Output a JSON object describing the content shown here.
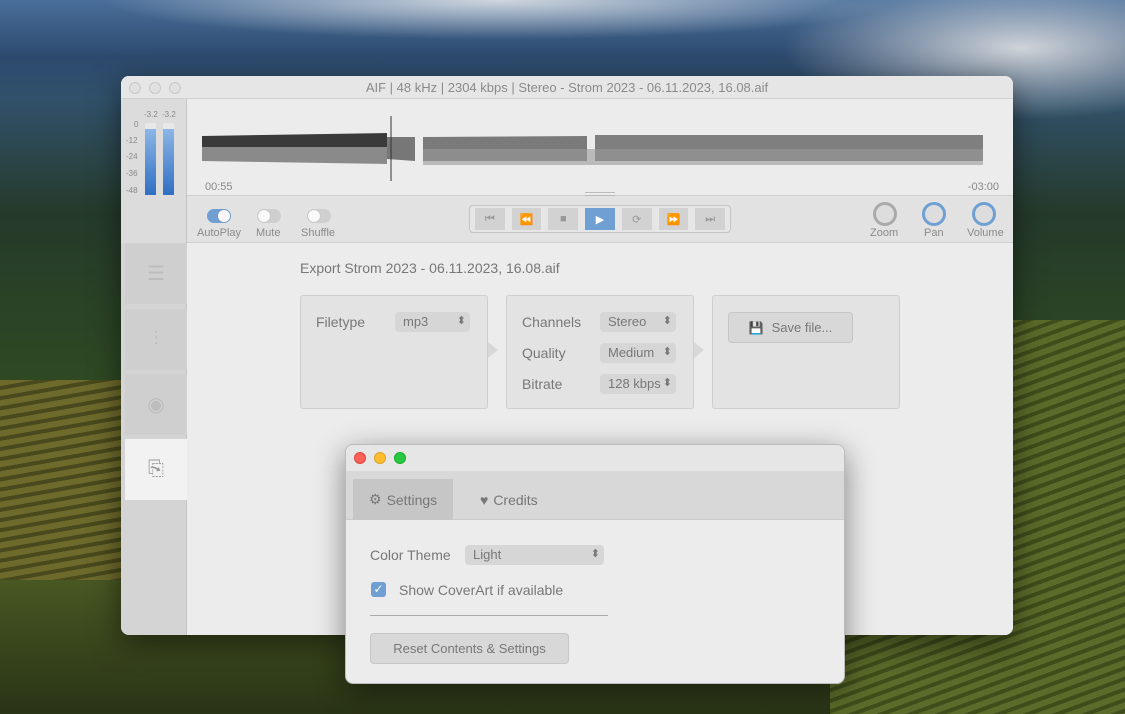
{
  "main_window": {
    "title": "AIF | 48 kHz | 2304 kbps | Stereo - Strom 2023 - 06.11.2023, 16.08.aif",
    "meter": {
      "peak_left": "-3.2",
      "peak_right": "-3.2",
      "scale": [
        "0",
        "-12",
        "-24",
        "-36",
        "-48"
      ],
      "level_left": 0.92,
      "level_right": 0.92
    },
    "waveform": {
      "elapsed": "00:55",
      "remaining": "-03:00",
      "playhead": 0.24
    },
    "toggles": [
      {
        "label": "AutoPlay",
        "on": true
      },
      {
        "label": "Mute",
        "on": false
      },
      {
        "label": "Shuffle",
        "on": false
      }
    ],
    "transport": [
      "skip-back-icon",
      "rewind-icon",
      "stop-icon",
      "play-icon",
      "repeat-icon",
      "fast-forward-icon",
      "skip-forward-icon"
    ],
    "knobs": [
      {
        "label": "Zoom"
      },
      {
        "label": "Pan"
      },
      {
        "label": "Volume"
      }
    ],
    "sidebar": [
      "playlist-icon",
      "equalizer-icon",
      "eye-icon",
      "export-icon"
    ],
    "export": {
      "heading": "Export Strom 2023 - 06.11.2023, 16.08.aif",
      "filetype_label": "Filetype",
      "filetype_value": "mp3",
      "channels_label": "Channels",
      "channels_value": "Stereo",
      "quality_label": "Quality",
      "quality_value": "Medium",
      "bitrate_label": "Bitrate",
      "bitrate_value": "128 kbps",
      "save_label": "Save file..."
    }
  },
  "dialog": {
    "tabs": [
      "Settings",
      "Credits"
    ],
    "color_theme_label": "Color Theme",
    "color_theme_value": "Light",
    "coverart_label": "Show CoverArt if available",
    "coverart_checked": true,
    "reset_label": "Reset Contents & Settings"
  },
  "colors": {
    "accent": "#6f9fd3"
  }
}
